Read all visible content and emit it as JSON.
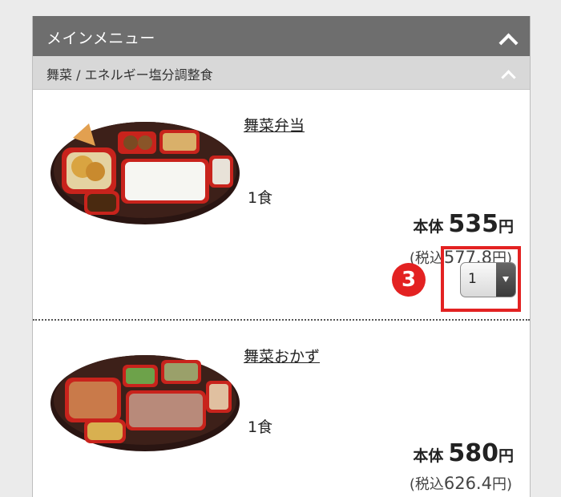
{
  "menu": {
    "title": "メインメニュー",
    "subcategory": "舞菜 / エネルギー塩分調整食"
  },
  "items": [
    {
      "name": "舞菜弁当",
      "quantity_label": "1食",
      "price_prefix": "本体",
      "price": "535",
      "price_unit": "円",
      "tax_prefix": "(税込",
      "tax_price": "577.8",
      "tax_suffix": "円)",
      "selected_qty": "1"
    },
    {
      "name": "舞菜おかず",
      "quantity_label": "1食",
      "price_prefix": "本体",
      "price": "580",
      "price_unit": "円",
      "tax_prefix": "(税込",
      "tax_price": "626.4",
      "tax_suffix": "円)"
    }
  ],
  "annotation": {
    "step_number": "3",
    "color": "#e32222"
  },
  "colors": {
    "header": "#6e6e6e",
    "subheader": "#d8d8d8",
    "bento_tray": "#3a1f1a",
    "bento_rim": "#c8231c"
  },
  "icons": {
    "collapse": "chevron-up-icon",
    "dropdown": "dropdown-arrow-icon"
  }
}
